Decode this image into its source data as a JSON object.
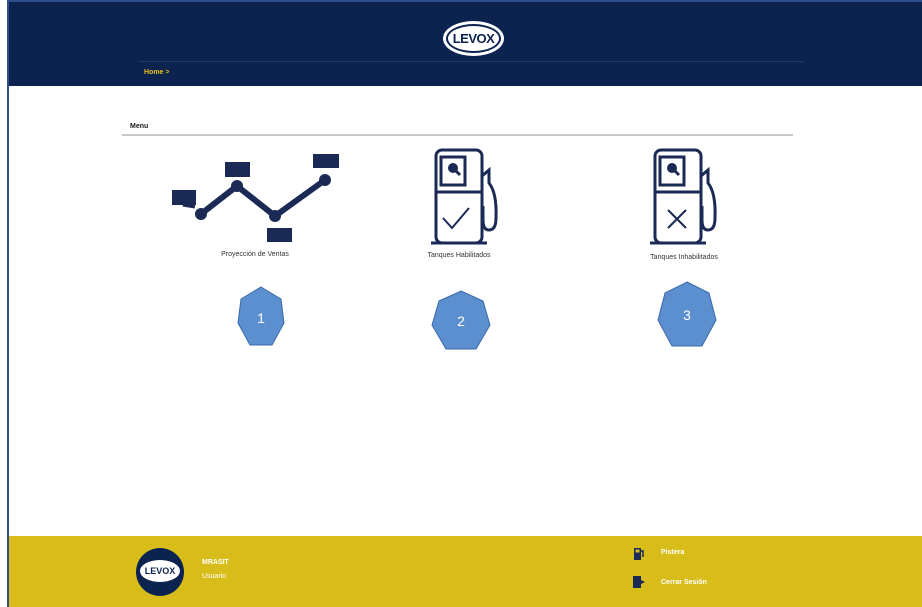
{
  "header": {
    "logo_text": "LEVOX",
    "breadcrumb": "Home >"
  },
  "menu": {
    "title": "Menu",
    "items": [
      {
        "label": "Proyección de Ventas",
        "icon": "line-chart-icon",
        "badge": "1"
      },
      {
        "label": "Tanques Habilitados",
        "icon": "fuel-pump-check-icon",
        "badge": "2"
      },
      {
        "label": "Tanques Inhabilitados",
        "icon": "fuel-pump-x-icon",
        "badge": "3"
      }
    ]
  },
  "footer": {
    "avatar_text": "LEVOX",
    "username": "MRASIT",
    "role": "Usuario",
    "links": [
      {
        "label": "Pistera",
        "icon": "fuel-pump-icon"
      },
      {
        "label": "Cerrar Sesión",
        "icon": "logout-door-icon"
      }
    ]
  },
  "colors": {
    "header_bg": "#0c2350",
    "footer_bg": "#d8bd1a",
    "accent_yellow": "#e8c21d",
    "badge_fill": "#5b8fcf",
    "icon_navy": "#1a2a55"
  }
}
